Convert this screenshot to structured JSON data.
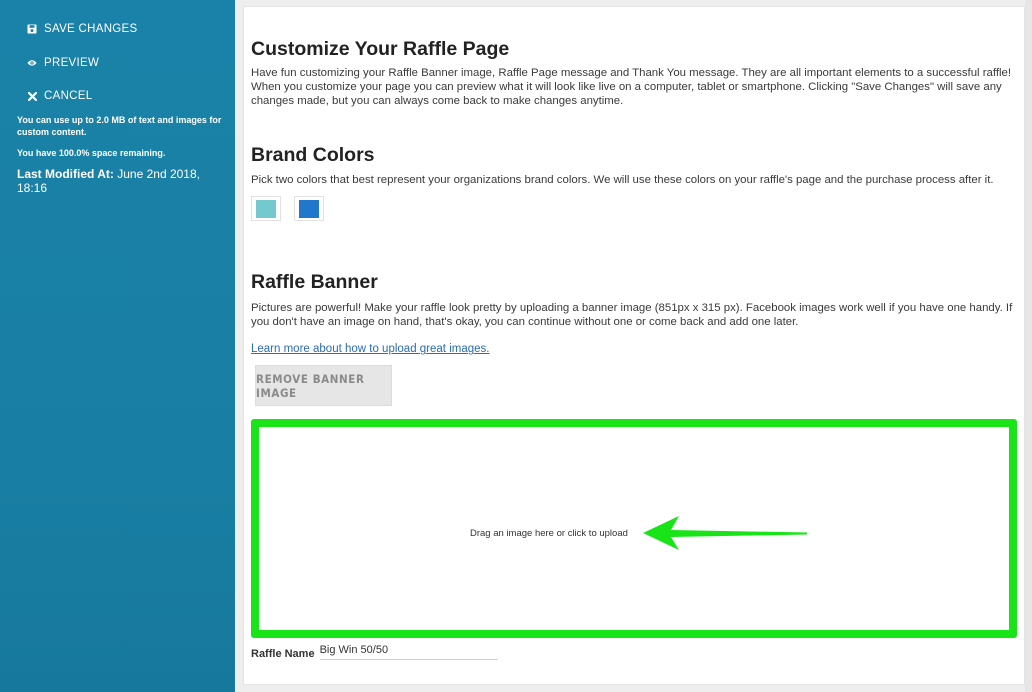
{
  "sidebar": {
    "items": [
      {
        "label": "SAVE CHANGES",
        "icon": "save-icon"
      },
      {
        "label": "PREVIEW",
        "icon": "eye-icon"
      },
      {
        "label": "CANCEL",
        "icon": "close-icon"
      }
    ],
    "info_space": "You can use up to 2.0 MB of text and images for custom content.",
    "info_remaining": "You have 100.0% space remaining.",
    "last_modified_label": "Last Modified At:",
    "last_modified_value": "June 2nd 2018, 18:16"
  },
  "customize": {
    "title": "Customize Your Raffle Page",
    "body": "Have fun customizing your Raffle Banner image, Raffle Page message and Thank You message. They are all important elements to a successful raffle! When you customize your page you can preview what it will look like live on a computer, tablet or smartphone. Clicking \"Save Changes\" will save any changes made, but you can always come back to make changes anytime."
  },
  "brand": {
    "title": "Brand Colors",
    "body": "Pick two colors that best represent your organizations brand colors. We will use these colors on your raffle's page and the purchase process after it.",
    "colors": [
      "#74c9cf",
      "#2077cc"
    ]
  },
  "banner": {
    "title": "Raffle Banner",
    "body": "Pictures are powerful! Make your raffle look pretty by uploading a banner image (851px x 315 px). Facebook images work well if you have one handy. If you don't have an image on hand, that's okay, you can continue without one or come back and add one later.",
    "link": "Learn more about how to upload great images.",
    "remove_button": "REMOVE BANNER IMAGE",
    "dropzone_text": "Drag an image here or click to upload"
  },
  "raffle": {
    "name_label": "Raffle Name",
    "name_value": "Big Win 50/50"
  },
  "colors": {
    "sidebar": "#1a82a8",
    "highlight": "#18e418",
    "link": "#2a6db0"
  }
}
